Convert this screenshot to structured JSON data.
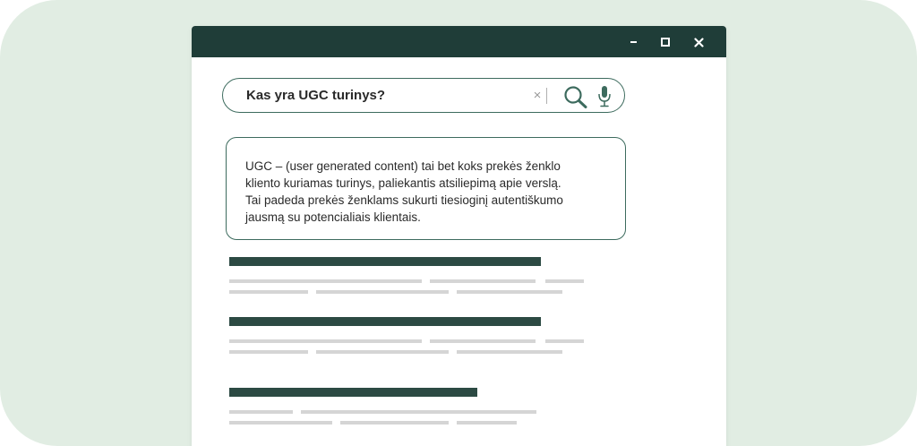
{
  "colors": {
    "backdrop": "#e1ede3",
    "titlebar": "#1f3d38",
    "accent": "#3d6b5e",
    "result_title_bar": "#2c4a43",
    "placeholder_line": "#d5d5d5"
  },
  "window_controls": {
    "minimize_icon": "minimize-icon",
    "maximize_icon": "maximize-icon",
    "close_icon": "close-icon",
    "close_glyph": "✕"
  },
  "search": {
    "query": "Kas yra UGC turinys?",
    "clear_glyph": "×",
    "icons": [
      "clear-icon",
      "search-icon",
      "microphone-icon"
    ]
  },
  "answer": {
    "lines": [
      "UGC – (user generated content) tai bet koks prekės ženklo",
      "kliento kuriamas turinys, paliekantis atsiliepimą apie verslą.",
      "Tai padeda prekės ženklams sukurti tiesioginį autentiškumo",
      "jausmą su potencialiais klientais."
    ]
  }
}
